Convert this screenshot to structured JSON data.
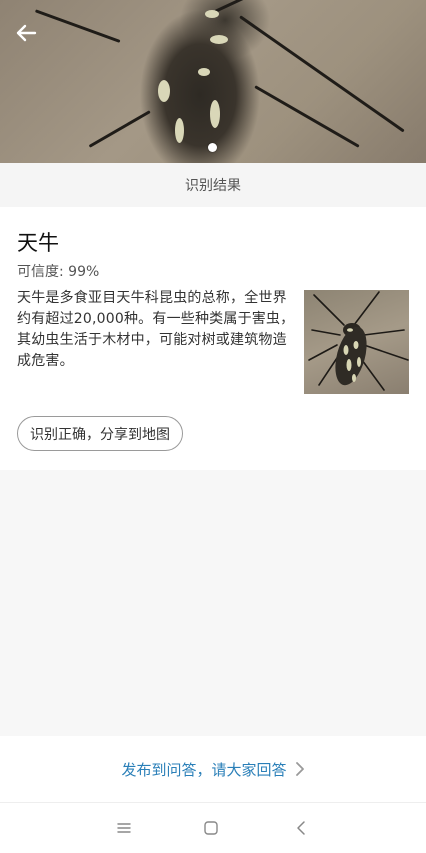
{
  "header": {
    "back_icon": "arrow-left-icon",
    "image_alt": "beetle photo",
    "carousel_dots": 1
  },
  "section_title": "识别结果",
  "result": {
    "name": "天牛",
    "confidence": "可信度: 99%",
    "description": "天牛是多食亚目天牛科昆虫的总称，全世界约有超过20,000种。有一些种类属于害虫，其幼虫生活于木材中，可能对树或建筑物造成危害。",
    "share_button": "识别正确，分享到地图"
  },
  "ask_bar": {
    "label": "发布到问答，请大家回答",
    "icon": "chevron-right-icon"
  },
  "nav": {
    "menu_icon": "menu-icon",
    "home_icon": "home-square-icon",
    "back_icon": "back-chevron-icon"
  },
  "colors": {
    "link": "#2a7fb8",
    "background": "#f7f7f7",
    "card": "#ffffff"
  }
}
